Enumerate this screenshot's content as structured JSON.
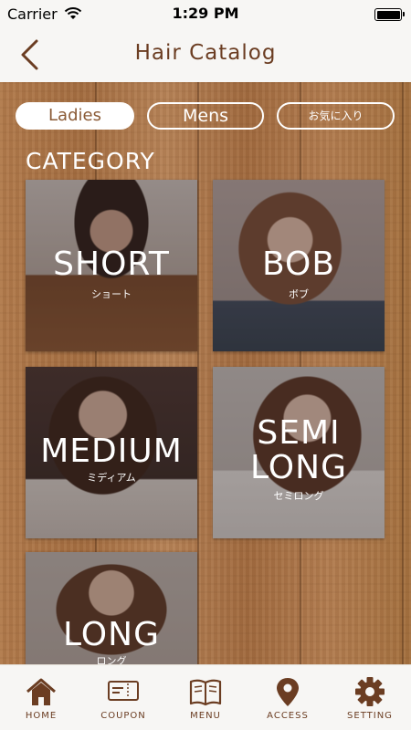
{
  "status_bar": {
    "carrier": "Carrier",
    "time": "1:29 PM"
  },
  "nav": {
    "title": "Hair Catalog"
  },
  "segments": [
    {
      "label": "Ladies",
      "selected": true
    },
    {
      "label": "Mens",
      "selected": false
    },
    {
      "label": "お気に入り",
      "selected": false
    }
  ],
  "category": {
    "heading": "CATEGORY",
    "items": [
      {
        "line1": "SHORT",
        "line2": "",
        "sub": "ショート"
      },
      {
        "line1": "BOB",
        "line2": "",
        "sub": "ボブ"
      },
      {
        "line1": "MEDIUM",
        "line2": "",
        "sub": "ミディアム"
      },
      {
        "line1": "SEMI",
        "line2": "LONG",
        "sub": "セミロング"
      },
      {
        "line1": "LONG",
        "line2": "",
        "sub": "ロング"
      }
    ]
  },
  "tabs": [
    {
      "label": "HOME",
      "icon": "home-icon"
    },
    {
      "label": "COUPON",
      "icon": "coupon-icon"
    },
    {
      "label": "MENU",
      "icon": "menu-book-icon"
    },
    {
      "label": "ACCESS",
      "icon": "map-pin-icon"
    },
    {
      "label": "SETTING",
      "icon": "gear-icon"
    }
  ],
  "colors": {
    "brand_brown": "#6b3d22",
    "wood": "#a97448",
    "bar_bg": "#f7f6f4"
  }
}
